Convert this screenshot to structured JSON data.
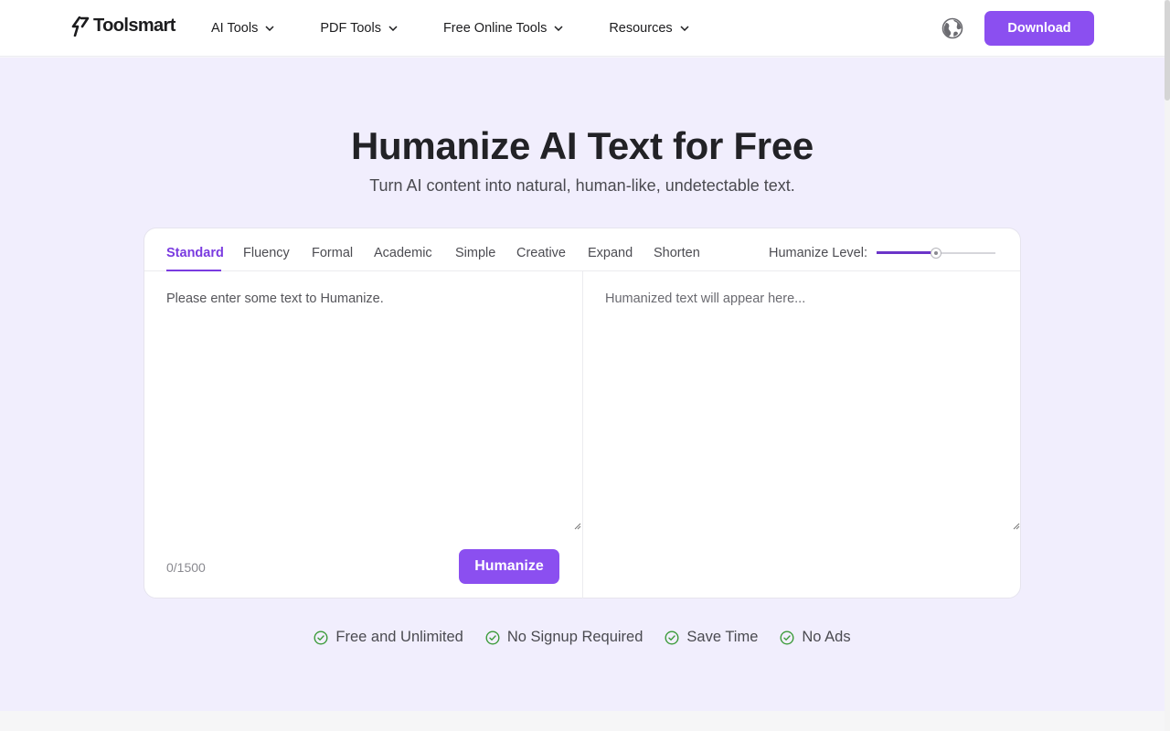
{
  "header": {
    "logo_text": "Toolsmart",
    "nav": [
      {
        "label": "AI Tools"
      },
      {
        "label": "PDF Tools"
      },
      {
        "label": "Free Online Tools"
      },
      {
        "label": "Resources"
      }
    ],
    "download_label": "Download"
  },
  "hero": {
    "title": "Humanize AI Text for Free",
    "subtitle": "Turn AI content into natural, human-like, undetectable text."
  },
  "tool": {
    "tabs": [
      {
        "label": "Standard",
        "active": true
      },
      {
        "label": "Fluency"
      },
      {
        "label": "Formal"
      },
      {
        "label": "Academic"
      },
      {
        "label": "Simple"
      },
      {
        "label": "Creative"
      },
      {
        "label": "Expand"
      },
      {
        "label": "Shorten"
      }
    ],
    "level_label": "Humanize Level:",
    "level_fraction": 0.5,
    "input_placeholder": "Please enter some text to Humanize.",
    "output_placeholder": "Humanized text will appear here...",
    "counter": "0/1500",
    "humanize_label": "Humanize"
  },
  "features": [
    {
      "label": "Free and Unlimited",
      "icon": "check-circle-icon"
    },
    {
      "label": "No Signup Required",
      "icon": "check-circle-icon"
    },
    {
      "label": "Save Time",
      "icon": "check-circle-icon"
    },
    {
      "label": "No Ads",
      "icon": "check-circle-icon"
    }
  ],
  "colors": {
    "accent": "#8b4ff0",
    "active_tab": "#7a3be0",
    "hero_bg": "#f1eefd",
    "check": "#3c9b3a"
  }
}
